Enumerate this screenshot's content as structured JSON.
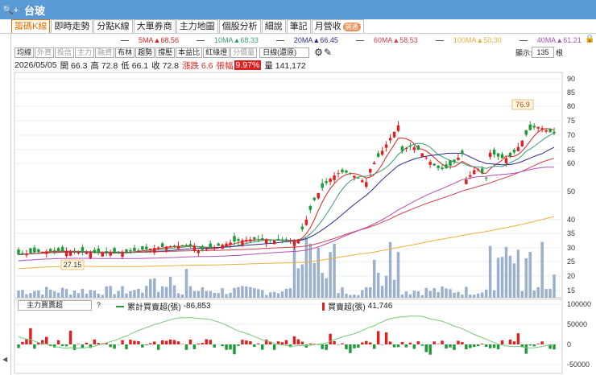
{
  "window": {
    "title": "台玻",
    "icon_label": "🔍+"
  },
  "tabs": [
    {
      "label": "籌碼K線",
      "active": true
    },
    {
      "label": "即時走勢"
    },
    {
      "label": "分點K線"
    },
    {
      "label": "大單券商"
    },
    {
      "label": "主力地圖"
    },
    {
      "label": "個股分析"
    },
    {
      "label": "細說"
    },
    {
      "label": "筆記"
    },
    {
      "label": "月營收",
      "badge": "開通"
    }
  ],
  "ma_legend": [
    {
      "label": "5MA",
      "value": "▲68.56",
      "color": "#e02020"
    },
    {
      "label": "10MA",
      "value": "▲68.33",
      "color": "#3a9a7a"
    },
    {
      "label": "20MA",
      "value": "▲66.45",
      "color": "#2a2a8a"
    },
    {
      "label": "60MA",
      "value": "▲58.53",
      "color": "#d04050"
    },
    {
      "label": "100MA",
      "value": "▲50.30",
      "color": "#e8b040"
    },
    {
      "label": "40MA",
      "value": "▲61.21",
      "color": "#b050b0"
    }
  ],
  "toolbar": {
    "buttons": [
      {
        "label": "均線"
      },
      {
        "label": "外資",
        "dim": true
      },
      {
        "label": "投信",
        "dim": true
      },
      {
        "label": "主力",
        "dim": true
      },
      {
        "label": "融資",
        "dim": true
      },
      {
        "label": "布林"
      },
      {
        "label": "趨勢"
      },
      {
        "label": "撐壓"
      },
      {
        "label": "本益比"
      },
      {
        "label": "紅綠燈"
      },
      {
        "label": "分價量",
        "dim": true
      }
    ],
    "gear_icon": "⚙",
    "pen_icon": "✎",
    "period": "日線(還原)",
    "display_label": "顯示:",
    "display_count": "135",
    "display_unit": "根"
  },
  "info": {
    "date": "2026/05/05",
    "open_label": "開",
    "open": "66.3",
    "high_label": "高",
    "high": "72.8",
    "low_label": "低",
    "low": "66.1",
    "close_label": "收",
    "close": "72.8",
    "change_label": "漲跌",
    "change": "6.6",
    "pct_label": "張幅",
    "pct": "9.97%",
    "vol_label": "量",
    "volume": "141,172"
  },
  "chart_data": {
    "type": "candlestick",
    "price_axis": [
      90,
      85,
      80,
      75,
      70,
      65,
      60,
      50,
      40,
      35,
      30,
      25,
      20,
      15
    ],
    "annotations": {
      "high": "76.9",
      "low": "27.15"
    },
    "indicator": {
      "selector": "主力買賣超",
      "help": "?",
      "cumulative_label": "累計買賣超(張)",
      "cumulative_value": "-86,853",
      "daily_label": "買賣超(張)",
      "daily_value": "41,746",
      "axis": [
        "100000",
        "50000",
        "0",
        "-50000"
      ]
    }
  },
  "colors": {
    "up": "#e02020",
    "down": "#1e9a38",
    "volume": "#9ab0cc",
    "accent": "#5b9bd5"
  }
}
